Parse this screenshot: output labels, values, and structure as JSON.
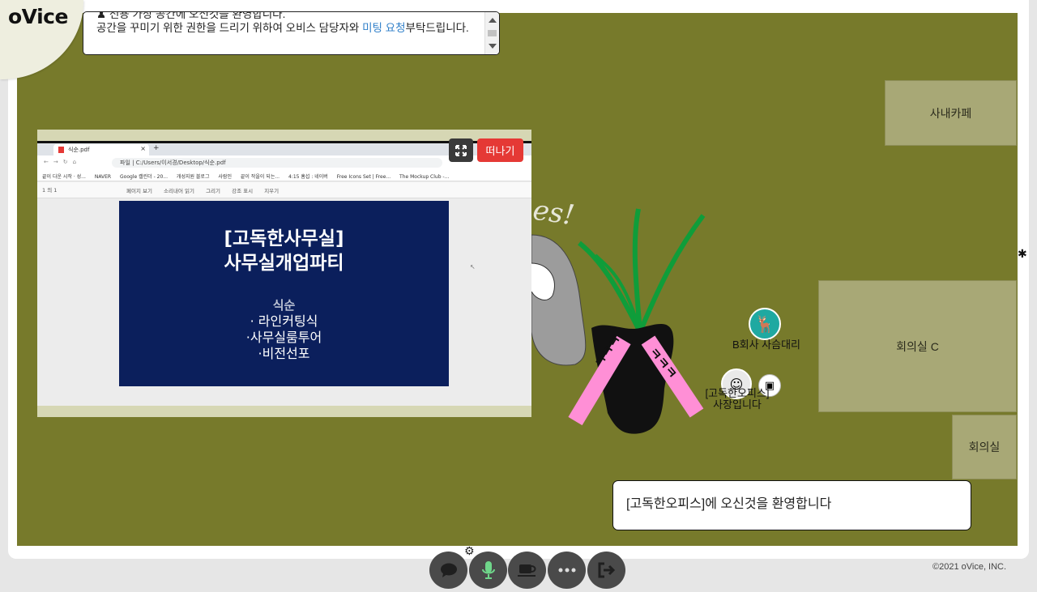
{
  "app": {
    "logo": "oVice",
    "copyright": "©2021 oVice, INC."
  },
  "notice": {
    "line1": "전용 가상 공간에 오신것을 환영합니다.",
    "line2_pre": "공간을 꾸미기 위한 권한을 드리기 위하여 오비스 담당자와 ",
    "line2_link": "미팅 요청",
    "line2_post": "부탁드립니다."
  },
  "rooms": {
    "cafe": "사내카페",
    "meeting_c": "회의실 C",
    "meeting": "회의실"
  },
  "screen_share": {
    "expand_icon": "expand-icon",
    "leave_label": "떠나기",
    "browser": {
      "tab_title": "식순.pdf",
      "address": "파일  |  C:/Users/이서경/Desktop/식순.pdf",
      "bookmarks": [
        "끝이 다운 시작 · 성...",
        "NAVER",
        "Google 캘린더 - 20...",
        "개성지원 블로그",
        "사람인",
        "끝이 작을이 되는...",
        "4:15 홈섭 : 네이버",
        "Free Icons Set | Free...",
        "The Mockup Club -..."
      ],
      "page_indicator": "1   의 1",
      "toolbar": [
        "페이지 보기",
        "소리내어 읽기",
        "그리기",
        "강조 표시",
        "지우기"
      ]
    },
    "slide": {
      "title_line1": "[고독한사무실]",
      "title_line2": "사무실개업파티",
      "subheading": "식순",
      "items": [
        "· 라인커팅식",
        "·사무실룸투어",
        "·비전선포"
      ]
    }
  },
  "avatars": {
    "user1": "B회사 사슴대리",
    "user2_line1": "[고독한오피스]",
    "user2_line2": "사장입니다"
  },
  "welcome_message": "[고독한오피스]에 오신것을 환영합니다",
  "controls": [
    {
      "name": "chat-button",
      "icon": "chat-icon"
    },
    {
      "name": "mic-button",
      "icon": "mic-icon"
    },
    {
      "name": "coffee-button",
      "icon": "coffee-icon"
    },
    {
      "name": "more-button",
      "icon": "more-icon"
    },
    {
      "name": "exit-button",
      "icon": "exit-icon"
    }
  ],
  "colors": {
    "floor": "#777a2b",
    "room": "#a8a876",
    "leave_button": "#e53935",
    "mic_active": "#6fd68a",
    "link": "#2f7fc9"
  }
}
